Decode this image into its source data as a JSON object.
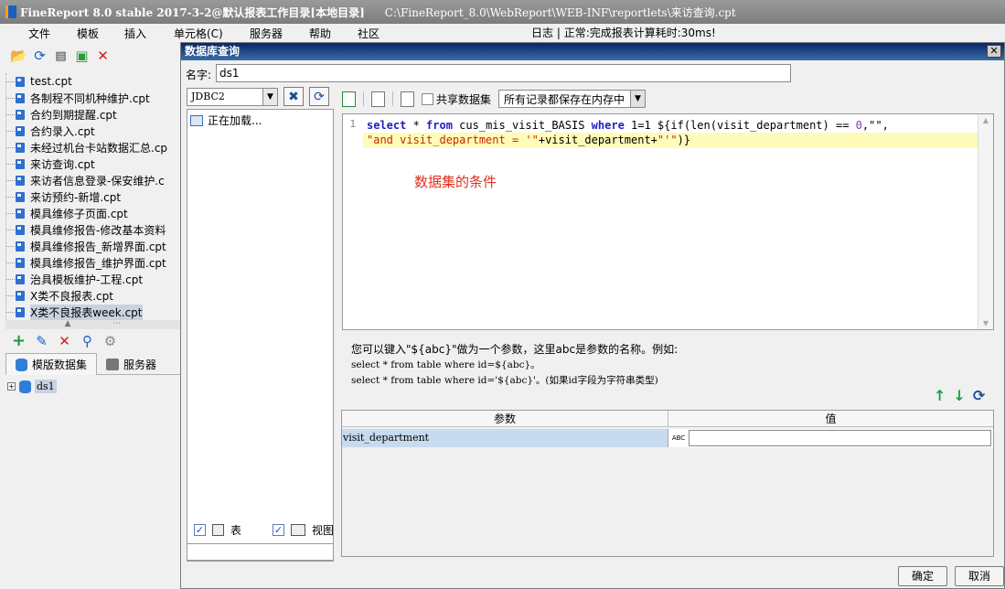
{
  "window": {
    "title": "FineReport 8.0 stable 2017-3-2@默认报表工作目录[本地目录]",
    "path": "C:\\FineReport_8.0\\WebReport\\WEB-INF\\reportlets\\来访查询.cpt"
  },
  "menu": {
    "items": [
      "文件",
      "模板",
      "插入",
      "单元格(C)",
      "服务器",
      "帮助",
      "社区"
    ],
    "log": "日志",
    "status": "正常:完成报表计算耗时:30ms!"
  },
  "left_toolbar": {
    "icons": [
      "open-folder-icon",
      "refresh-icon",
      "properties-icon",
      "new-template-icon",
      "delete-icon"
    ]
  },
  "files": [
    "test.cpt",
    "各制程不同机种维护.cpt",
    "合约到期提醒.cpt",
    "合约录入.cpt",
    "未经过机台卡站数据汇总.cp",
    "来访查询.cpt",
    "来访者信息登录-保安维护.c",
    "来访预约-新增.cpt",
    "模具维修子页面.cpt",
    "模具维修报告-修改基本资料",
    "模具维修报告_新增界面.cpt",
    "模具维修报告_维护界面.cpt",
    "治具模板维护-工程.cpt",
    "X类不良报表.cpt",
    "X类不良报表week.cpt"
  ],
  "dataset_tabs": {
    "tab1": "模版数据集",
    "tab2": "服务器"
  },
  "dataset_node": "ds1",
  "dialog": {
    "title": "数据库查询",
    "close": "✕",
    "name_label": "名字:",
    "name_value": "ds1",
    "connection": "JDBC2",
    "loading": "正在加载...",
    "table_label": "表",
    "view_label": "视图",
    "share_label": "共享数据集",
    "memory_option": "所有记录都保存在内存中",
    "line_number": "1",
    "annotation": "数据集的条件",
    "hint_line1": "您可以键入\"${abc}\"做为一个参数，这里abc是参数的名称。例如:",
    "hint_line2": "select * from table where id=${abc}。",
    "hint_line3": "select * from table where id='${abc}'。(如果id字段为字符串类型)",
    "param_header_name": "参数",
    "param_header_value": "值",
    "param_name": "visit_department",
    "param_value_type": "ABC",
    "ok_button": "确定",
    "cancel_button": "取消"
  },
  "sql": {
    "kw_select": "select",
    "star": " * ",
    "kw_from": "from",
    "table": " cus_mis_visit_BASIS ",
    "kw_where": "where",
    "cond": " 1=1 ${if(len(visit_department) == ",
    "zero": "0",
    "tail1": ",\"\",",
    "line2_str": "\"and visit_department = '\"",
    "line2_rest": "+visit_department+",
    "line2_str2": "\"'\"",
    "line2_end": ")}"
  }
}
